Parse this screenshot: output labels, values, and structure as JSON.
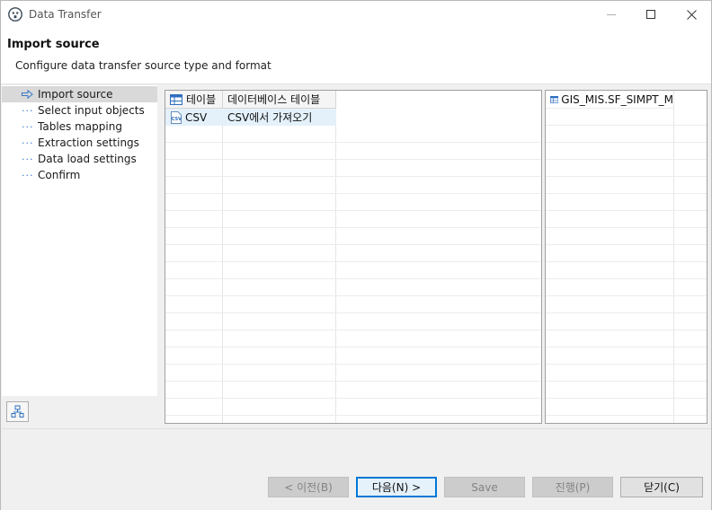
{
  "window": {
    "title": "Data Transfer",
    "icon": "dbeaver-beaver-icon"
  },
  "header": {
    "title": "Import source",
    "description": "Configure data transfer source type and format"
  },
  "nav": {
    "items": [
      {
        "label": "Import source",
        "marker": "arrow-right-icon",
        "active": true
      },
      {
        "label": "Select input objects",
        "marker": "dots-icon",
        "active": false
      },
      {
        "label": "Tables mapping",
        "marker": "dots-icon",
        "active": false
      },
      {
        "label": "Extraction settings",
        "marker": "dots-icon",
        "active": false
      },
      {
        "label": "Data load settings",
        "marker": "dots-icon",
        "active": false
      },
      {
        "label": "Confirm",
        "marker": "dots-icon",
        "active": false
      }
    ]
  },
  "source_table": {
    "columns": [
      "테이블",
      "데이터베이스 테이블"
    ],
    "rows": [
      {
        "name": "CSV",
        "description": "CSV에서 가져오기",
        "selected": true
      }
    ]
  },
  "target_table": {
    "header": "GIS_MIS.SF_SIMPT_M"
  },
  "buttons": {
    "back": "< 이전(B)",
    "next": "다음(N) >",
    "save": "Save",
    "proceed": "진행(P)",
    "close": "닫기(C)"
  },
  "colors": {
    "accent": "#0078d7",
    "selection": "#e4f1fb",
    "nav_active": "#d9d9d9"
  }
}
